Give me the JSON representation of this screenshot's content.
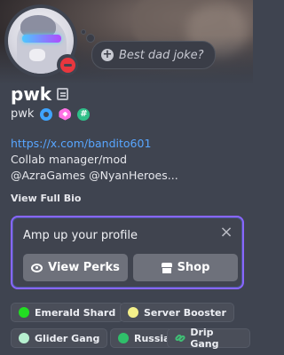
{
  "profile": {
    "display_name": "pwk",
    "username": "pwk",
    "status_placeholder": "Best dad joke?",
    "bio_link": "https://x.com/bandito601",
    "bio_line1": "Collab manager/mod",
    "bio_line2": "@AzraGames @NyanHeroes...",
    "view_full_bio": "View Full Bio",
    "status": "do-not-disturb"
  },
  "perks": {
    "title": "Amp up your profile",
    "view_perks_label": "View Perks",
    "shop_label": "Shop",
    "border_color": "#8866ff"
  },
  "roles": [
    {
      "name": "Emerald Shard",
      "color": "#22dd22"
    },
    {
      "name": "Server Booster",
      "color": "#f4f08a"
    },
    {
      "name": "Glider Gang",
      "color": "#b7f0d0"
    },
    {
      "name": "Russia",
      "color": "#2fbf6a"
    },
    {
      "name": "Drip Gang",
      "color": "#3fbf75",
      "icon": "link-icon"
    }
  ],
  "colors": {
    "link": "#58a6ff",
    "dnd": "#e8373e",
    "nitro_badge": "#3fa4ff",
    "boost_badge": "#ff72e5",
    "hash_badge": "#2fbf89"
  }
}
